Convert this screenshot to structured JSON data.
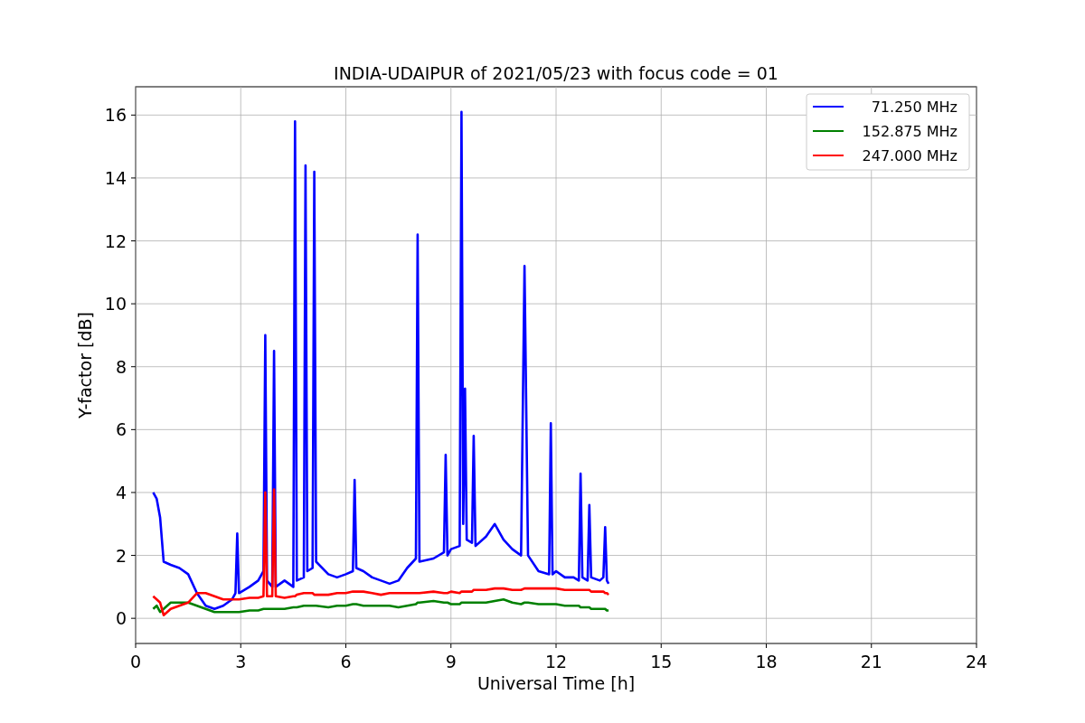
{
  "chart_data": {
    "type": "line",
    "grid": true,
    "legend": true,
    "title": "INDIA-UDAIPUR of 2021/05/23 with focus code = 01",
    "xlabel": "Universal Time [h]",
    "ylabel": "Y-factor [dB]",
    "xlim": [
      0,
      24
    ],
    "ylim": [
      -0.8,
      16.9
    ],
    "xticks": [
      0,
      3,
      6,
      9,
      12,
      15,
      18,
      21,
      24
    ],
    "yticks": [
      0,
      2,
      4,
      6,
      8,
      10,
      12,
      14,
      16
    ],
    "x": [
      0.5,
      0.6,
      0.7,
      0.8,
      1.0,
      1.25,
      1.5,
      1.75,
      2.0,
      2.25,
      2.5,
      2.75,
      2.85,
      2.9,
      2.95,
      3.25,
      3.5,
      3.65,
      3.7,
      3.75,
      3.9,
      3.95,
      4.0,
      4.25,
      4.5,
      4.55,
      4.6,
      4.8,
      4.85,
      4.9,
      5.05,
      5.1,
      5.15,
      5.5,
      5.75,
      6.0,
      6.2,
      6.25,
      6.3,
      6.5,
      6.75,
      7.0,
      7.25,
      7.5,
      7.75,
      8.0,
      8.05,
      8.1,
      8.5,
      8.8,
      8.85,
      8.9,
      9.0,
      9.25,
      9.3,
      9.35,
      9.4,
      9.45,
      9.6,
      9.65,
      9.7,
      10.0,
      10.25,
      10.5,
      10.75,
      11.0,
      11.1,
      11.2,
      11.5,
      11.8,
      11.85,
      11.9,
      12.0,
      12.25,
      12.5,
      12.65,
      12.7,
      12.75,
      12.9,
      12.95,
      13.0,
      13.25,
      13.35,
      13.4,
      13.45,
      13.5
    ],
    "series": [
      {
        "name": "71.250 MHz",
        "color": "#0000ff",
        "values": [
          4.0,
          3.8,
          3.2,
          1.8,
          1.7,
          1.6,
          1.4,
          0.8,
          0.4,
          0.3,
          0.4,
          0.6,
          0.8,
          2.7,
          0.8,
          1.0,
          1.2,
          1.5,
          9.0,
          1.2,
          1.0,
          8.5,
          1.0,
          1.2,
          1.0,
          15.8,
          1.2,
          1.3,
          14.4,
          1.5,
          1.6,
          14.2,
          1.8,
          1.4,
          1.3,
          1.4,
          1.5,
          4.4,
          1.6,
          1.5,
          1.3,
          1.2,
          1.1,
          1.2,
          1.6,
          1.9,
          12.2,
          1.8,
          1.9,
          2.1,
          5.2,
          2.0,
          2.2,
          2.3,
          16.1,
          3.0,
          7.3,
          2.5,
          2.4,
          5.8,
          2.3,
          2.6,
          3.0,
          2.5,
          2.2,
          2.0,
          11.2,
          2.0,
          1.5,
          1.4,
          6.2,
          1.4,
          1.5,
          1.3,
          1.3,
          1.2,
          4.6,
          1.3,
          1.2,
          3.6,
          1.3,
          1.2,
          1.3,
          2.9,
          1.2,
          1.1
        ]
      },
      {
        "name": "152.875 MHz",
        "color": "#008000",
        "values": [
          0.3,
          0.4,
          0.2,
          0.3,
          0.5,
          0.5,
          0.5,
          0.4,
          0.3,
          0.2,
          0.2,
          0.2,
          0.2,
          0.2,
          0.2,
          0.25,
          0.25,
          0.3,
          0.3,
          0.3,
          0.3,
          0.3,
          0.3,
          0.3,
          0.35,
          0.35,
          0.35,
          0.4,
          0.4,
          0.4,
          0.4,
          0.4,
          0.4,
          0.35,
          0.4,
          0.4,
          0.45,
          0.45,
          0.45,
          0.4,
          0.4,
          0.4,
          0.4,
          0.35,
          0.4,
          0.45,
          0.5,
          0.5,
          0.55,
          0.5,
          0.5,
          0.5,
          0.45,
          0.45,
          0.5,
          0.5,
          0.5,
          0.5,
          0.5,
          0.5,
          0.5,
          0.5,
          0.55,
          0.6,
          0.5,
          0.45,
          0.5,
          0.5,
          0.45,
          0.45,
          0.45,
          0.45,
          0.45,
          0.4,
          0.4,
          0.4,
          0.35,
          0.35,
          0.35,
          0.35,
          0.3,
          0.3,
          0.3,
          0.3,
          0.25,
          0.25
        ]
      },
      {
        "name": "247.000 MHz",
        "color": "#ff0000",
        "values": [
          0.7,
          0.6,
          0.5,
          0.1,
          0.3,
          0.4,
          0.5,
          0.8,
          0.8,
          0.7,
          0.6,
          0.6,
          0.6,
          0.6,
          0.6,
          0.65,
          0.65,
          0.7,
          4.0,
          0.7,
          0.7,
          4.1,
          0.7,
          0.65,
          0.7,
          0.7,
          0.75,
          0.8,
          0.8,
          0.8,
          0.8,
          0.75,
          0.75,
          0.75,
          0.8,
          0.8,
          0.85,
          0.85,
          0.85,
          0.85,
          0.8,
          0.75,
          0.8,
          0.8,
          0.8,
          0.8,
          0.8,
          0.8,
          0.85,
          0.8,
          0.8,
          0.8,
          0.85,
          0.8,
          0.85,
          0.85,
          0.85,
          0.85,
          0.85,
          0.9,
          0.9,
          0.9,
          0.95,
          0.95,
          0.9,
          0.9,
          0.95,
          0.95,
          0.95,
          0.95,
          0.95,
          0.95,
          0.95,
          0.9,
          0.9,
          0.9,
          0.9,
          0.9,
          0.9,
          0.9,
          0.85,
          0.85,
          0.85,
          0.8,
          0.8,
          0.75
        ]
      }
    ]
  }
}
